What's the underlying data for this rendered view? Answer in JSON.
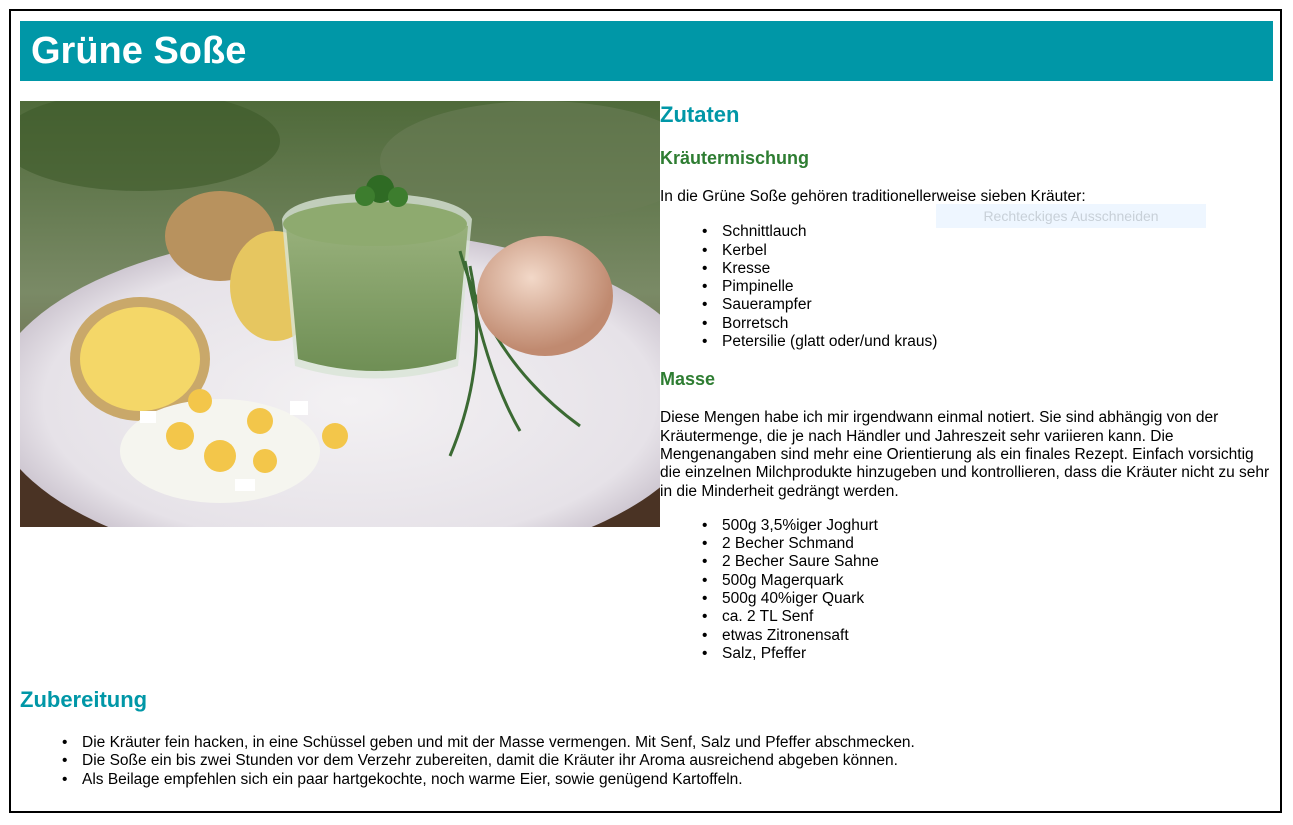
{
  "title": "Grüne Soße",
  "zutaten": {
    "heading": "Zutaten",
    "kraeuter": {
      "heading": "Kräutermischung",
      "intro": "In die Grüne Soße gehören traditionellerweise sieben Kräuter:",
      "items": [
        "Schnittlauch",
        "Kerbel",
        "Kresse",
        "Pimpinelle",
        "Sauerampfer",
        "Borretsch",
        "Petersilie (glatt oder/und kraus)"
      ]
    },
    "masse": {
      "heading": "Masse",
      "intro": "Diese Mengen habe ich mir irgendwann einmal notiert. Sie sind abhängig von der Kräutermenge, die je nach Händler und Jahreszeit sehr variieren kann. Die Mengenangaben sind mehr eine Orientierung als ein finales Rezept. Einfach vorsichtig die einzelnen Milchprodukte hinzugeben und kontrollieren, dass die Kräuter nicht zu sehr in die Minderheit gedrängt werden.",
      "items": [
        "500g 3,5%iger Joghurt",
        "2 Becher Schmand",
        "2 Becher Saure Sahne",
        "500g Magerquark",
        "500g 40%iger Quark",
        "ca. 2 TL Senf",
        "etwas Zitronensaft",
        "Salz, Pfeffer"
      ]
    }
  },
  "zubereitung": {
    "heading": "Zubereitung",
    "items": [
      "Die Kräuter fein hacken, in eine Schüssel geben und mit der Masse vermengen. Mit Senf, Salz und Pfeffer abschmecken.",
      "Die Soße ein bis zwei Stunden vor dem Verzehr zubereiten, damit die Kräuter ihr Aroma ausreichend abgeben können.",
      "Als Beilage empfehlen sich ein paar hartgekochte, noch warme Eier, sowie genügend Kartoffeln."
    ]
  },
  "overlay": {
    "tooltip": "Rechteckiges Ausschneiden"
  },
  "colors": {
    "accent": "#0097a7",
    "subheading": "#2e7d32"
  }
}
